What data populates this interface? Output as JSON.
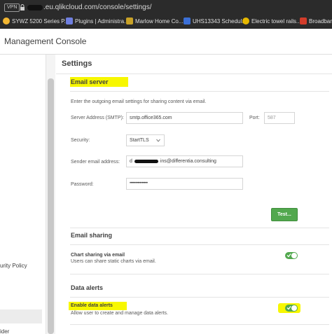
{
  "browser": {
    "vpn_label": "VPN",
    "url": ".eu.qlikcloud.com/console/settings/",
    "bookmarks": [
      {
        "label": "SYWZ 5200 Series P...",
        "color": "#f2b632"
      },
      {
        "label": "Plugins | Administra...",
        "color": "#6f7fe0"
      },
      {
        "label": "Marlow Home Co...",
        "color": "#c9a227"
      },
      {
        "label": "UHS13343 Schedul...",
        "color": "#3b6fd6"
      },
      {
        "label": "Electric towel rails...",
        "color": "#e6b800"
      },
      {
        "label": "Broadband",
        "color": "#d23c2a"
      }
    ]
  },
  "header": {
    "title": "Management Console"
  },
  "sidebar": {
    "fragments": [
      "urity Policy",
      "ider"
    ]
  },
  "main": {
    "title": "Settings",
    "email_server": {
      "title": "Email server",
      "description": "Enter the outgoing email settings for sharing content via email.",
      "server_label": "Server Address (SMTP):",
      "server_value": "smtp.office365.com",
      "port_label": "Port:",
      "port_placeholder": "587",
      "security_label": "Security:",
      "security_value": "StartTLS",
      "sender_label": "Sender email address:",
      "sender_prefix": "d",
      "sender_suffix": "ins@differentia.consulting",
      "password_label": "Password:",
      "password_value": "••••••••••••••••",
      "test_button": "Test..."
    },
    "email_sharing": {
      "title": "Email sharing",
      "item_title": "Chart sharing via email",
      "item_desc": "Users can share static charts via email.",
      "enabled": true
    },
    "data_alerts": {
      "title": "Data alerts",
      "item_title": "Enable data alerts",
      "item_desc": "Allow user to create and manage data alerts.",
      "enabled": true
    }
  },
  "colors": {
    "accent_green": "#52a84e",
    "highlight": "#f7f700"
  }
}
